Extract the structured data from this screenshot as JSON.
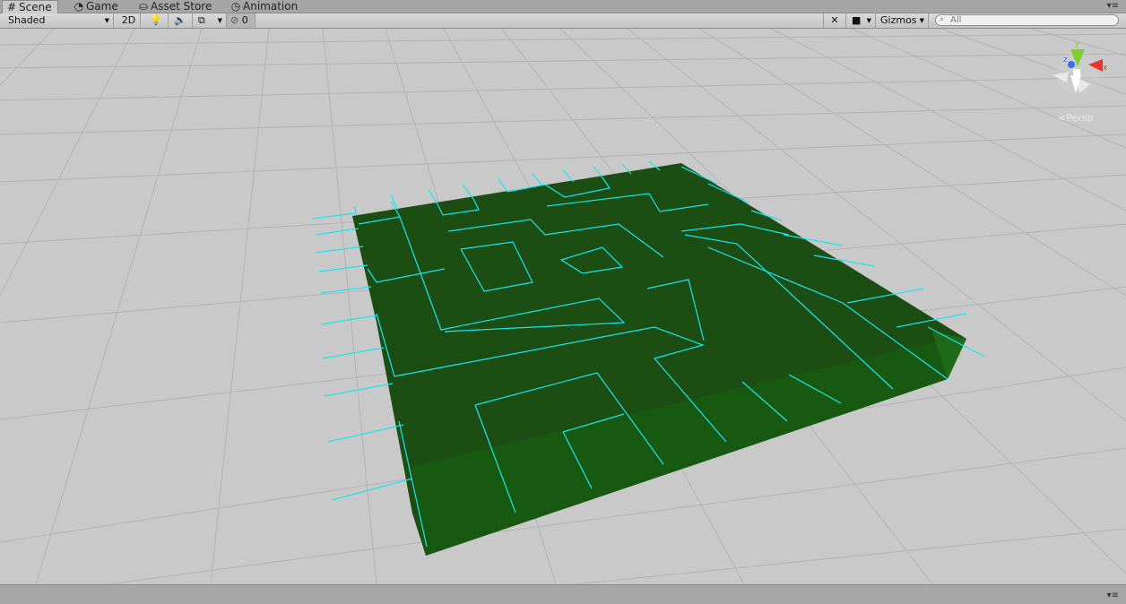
{
  "tabs": [
    {
      "label": "Scene",
      "icon": "grid-icon",
      "active": true
    },
    {
      "label": "Game",
      "icon": "pacman-icon",
      "active": false
    },
    {
      "label": "Asset Store",
      "icon": "bag-icon",
      "active": false
    },
    {
      "label": "Animation",
      "icon": "clock-icon",
      "active": false
    }
  ],
  "toolbar": {
    "draw_mode": "Shaded",
    "mode_2d": "2D",
    "hidden_count": "0",
    "gizmos_label": "Gizmos",
    "search_placeholder": "All"
  },
  "scene_gizmo": {
    "axis_y": "y",
    "axis_x": "x",
    "axis_z": "z",
    "projection": "Persp"
  },
  "colors": {
    "maze_top": "#1c4d12",
    "maze_side": "#175c12",
    "wall_lines": "#19e6f0",
    "grid_lines": "#b3b3b3",
    "axis_x": "#e8342c",
    "axis_y": "#7fcf2c",
    "axis_z": "#3b6ee8"
  }
}
